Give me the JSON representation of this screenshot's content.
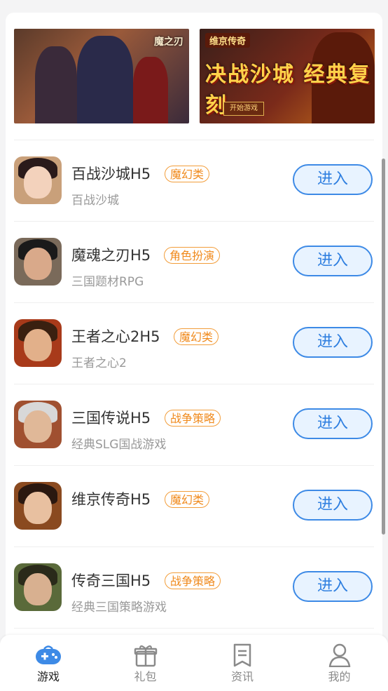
{
  "banners": {
    "left": {
      "logo": "魔之刃"
    },
    "right": {
      "corner": "维京传奇",
      "headline": "决战沙城 经典复刻",
      "button": "开始游戏"
    }
  },
  "games": [
    {
      "name": "百战沙城H5",
      "tag": "魔幻类",
      "desc": "百战沙城",
      "button": "进入",
      "colors": {
        "bg": "#c9a07a",
        "hair": "#2a1a1a",
        "face": "#f3d2bc"
      }
    },
    {
      "name": "魔魂之刃H5",
      "tag": "角色扮演",
      "desc": "三国题材RPG",
      "button": "进入",
      "colors": {
        "bg": "#7a6a5a",
        "hair": "#1a1a1a",
        "face": "#d9a98a"
      }
    },
    {
      "name": "王者之心2H5",
      "tag": "魔幻类",
      "desc": "王者之心2",
      "button": "进入",
      "colors": {
        "bg": "#a83a1a",
        "hair": "#3a2010",
        "face": "#e2b08a"
      }
    },
    {
      "name": "三国传说H5",
      "tag": "战争策略",
      "desc": "经典SLG国战游戏",
      "button": "进入",
      "colors": {
        "bg": "#a05030",
        "hair": "#d8d8d8",
        "face": "#e0b898"
      }
    },
    {
      "name": "维京传奇H5",
      "tag": "魔幻类",
      "desc": "",
      "button": "进入",
      "colors": {
        "bg": "#8a4a20",
        "hair": "#2a1810",
        "face": "#e8c0a0"
      }
    },
    {
      "name": "传奇三国H5",
      "tag": "战争策略",
      "desc": "经典三国策略游戏",
      "button": "进入",
      "colors": {
        "bg": "#5a6a3a",
        "hair": "#2a2a1a",
        "face": "#d8b090"
      }
    }
  ],
  "tabs": [
    {
      "label": "游戏",
      "icon": "gamepad-icon",
      "active": true
    },
    {
      "label": "礼包",
      "icon": "gift-icon",
      "active": false
    },
    {
      "label": "资讯",
      "icon": "news-icon",
      "active": false
    },
    {
      "label": "我的",
      "icon": "user-icon",
      "active": false
    }
  ],
  "colors": {
    "accent": "#3d8ae6",
    "tag": "#f29d3a",
    "inactive": "#8a8a8a"
  }
}
